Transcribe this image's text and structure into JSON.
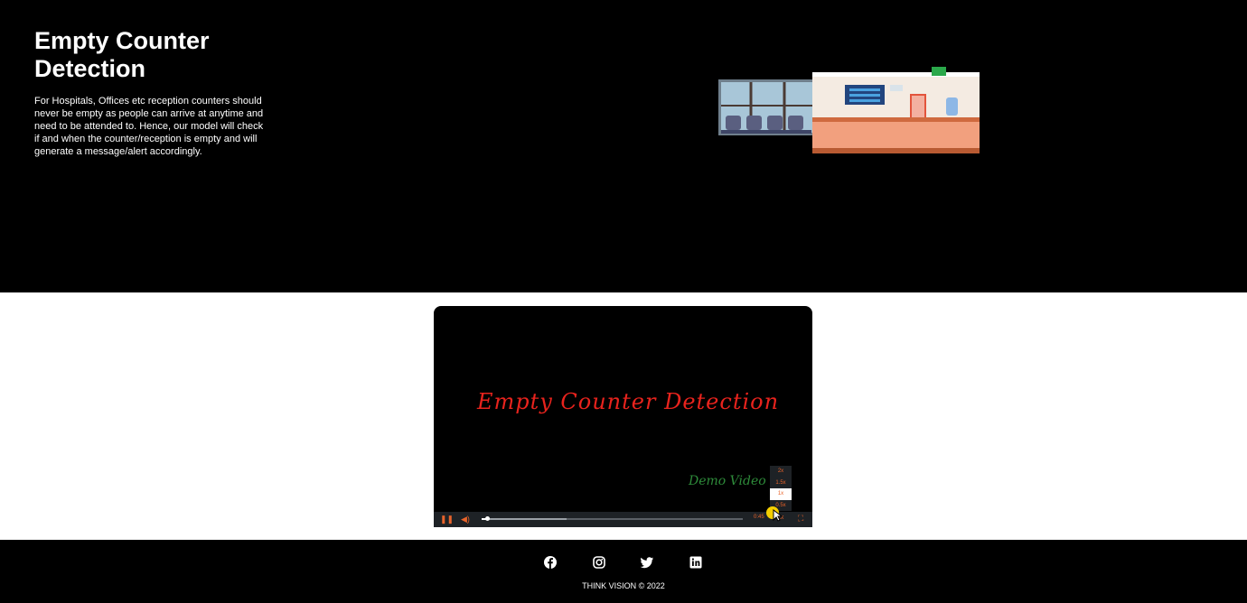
{
  "hero": {
    "title": "Empty Counter Detection",
    "description": "For Hospitals, Offices etc reception counters should never be empty as people can arrive at anytime and need to be attended to. Hence, our model will check if and when the counter/reception is empty and will generate a message/alert accordingly."
  },
  "video": {
    "frame_title": "Empty Counter Detection",
    "frame_subtitle": "Demo Video",
    "progress_played": 0.02,
    "progress_buffered": 0.32,
    "time_remaining": "0:45",
    "speed_button": "1x",
    "speed_options": [
      "2x",
      "1.5x",
      "1x",
      "0.5x"
    ],
    "selected_speed": "1x"
  },
  "footer": {
    "social": [
      "facebook-icon",
      "instagram-icon",
      "twitter-icon",
      "linkedin-icon"
    ],
    "copyright": "THINK VISION © 2022"
  },
  "colors": {
    "background": "#000000",
    "accent": "#e8632a",
    "video_title": "#e8231d",
    "video_subtitle": "#2e8b3a"
  }
}
